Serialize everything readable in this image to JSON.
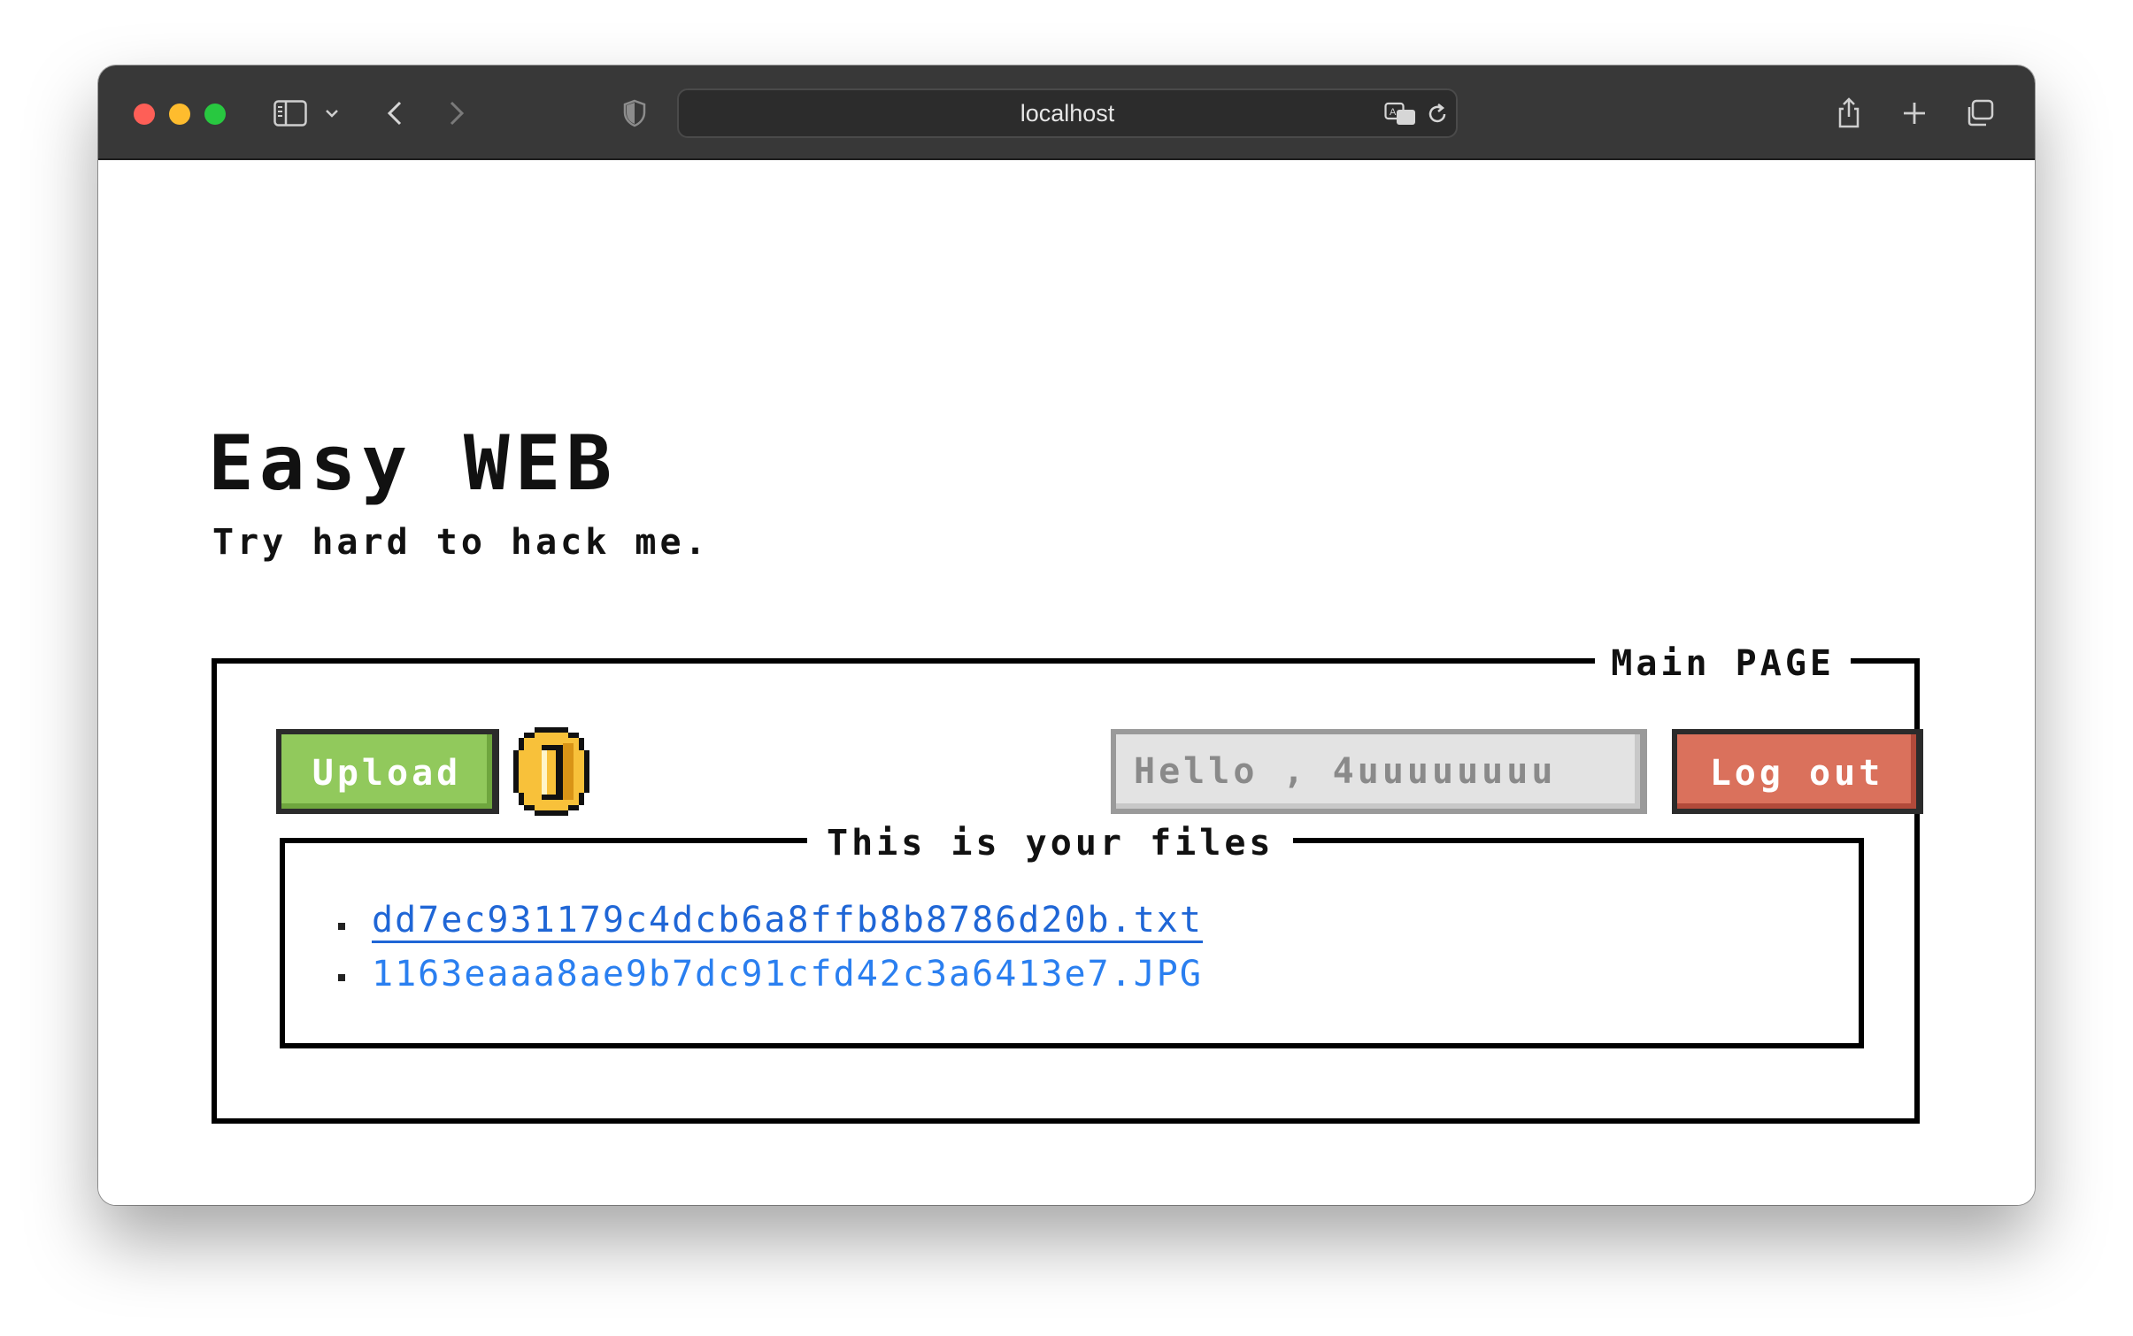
{
  "browser": {
    "url": "localhost",
    "icons": {
      "sidebar": "sidebar-toggle-icon",
      "chevron": "chevron-down-icon",
      "back": "back-arrow-icon",
      "forward": "forward-arrow-icon",
      "shield": "privacy-shield-icon",
      "translate": "translate-icon",
      "reload": "reload-icon",
      "share": "share-icon",
      "new_tab": "plus-icon",
      "tabs": "tabs-overview-icon"
    }
  },
  "site": {
    "title": "Easy WEB",
    "subtitle": "Try hard to hack me."
  },
  "main_box": {
    "legend": "Main PAGE",
    "upload_label": "Upload",
    "coin_icon": "coin-icon",
    "greeting": "Hello , 4uuuuuuuu",
    "logout_label": "Log out"
  },
  "files_box": {
    "legend": "This is your files",
    "files": [
      {
        "name": "dd7ec931179c4dcb6a8ffb8b8786d20b.txt"
      },
      {
        "name": "1163eaaa8ae9b7dc91cfd42c3a6413e7.JPG"
      }
    ]
  },
  "colors": {
    "upload_green": "#91c95c",
    "logout_red": "#da715c",
    "link_blue": "#1f66d6",
    "titlebar": "#383838"
  }
}
